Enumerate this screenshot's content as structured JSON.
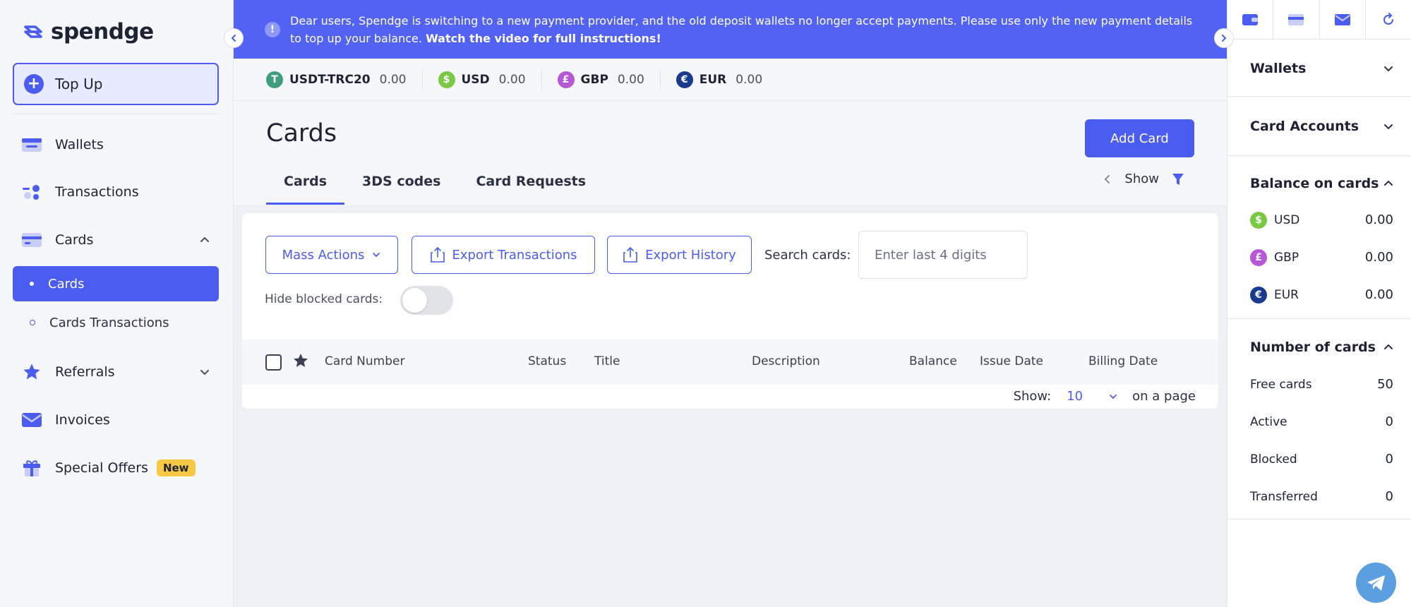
{
  "app": {
    "logo_text": "spendge"
  },
  "sidebar": {
    "topup_label": "Top Up",
    "items": [
      {
        "label": "Wallets"
      },
      {
        "label": "Transactions"
      },
      {
        "label": "Cards"
      },
      {
        "label": "Referrals"
      },
      {
        "label": "Invoices"
      },
      {
        "label": "Special Offers",
        "badge": "New"
      }
    ],
    "cards_sub": [
      {
        "label": "Cards",
        "active": true
      },
      {
        "label": "Cards Transactions",
        "active": false
      }
    ]
  },
  "banner": {
    "text": "Dear users, Spendge is switching to a new payment provider, and the old deposit wallets no longer accept payments. Please use only the new payment details to top up your balance.",
    "link": "Watch the video for full instructions!"
  },
  "balances": [
    {
      "name": "USDT-TRC20",
      "value": "0.00",
      "symbol": "T",
      "color": "#3e9e7c"
    },
    {
      "name": "USD",
      "value": "0.00",
      "symbol": "$",
      "color": "#7ac943"
    },
    {
      "name": "GBP",
      "value": "0.00",
      "symbol": "£",
      "color": "#b557d6"
    },
    {
      "name": "EUR",
      "value": "0.00",
      "symbol": "€",
      "color": "#1a3a8f"
    }
  ],
  "page": {
    "title": "Cards",
    "add_card_label": "Add Card",
    "tabs": [
      {
        "label": "Cards",
        "active": true
      },
      {
        "label": "3DS codes",
        "active": false
      },
      {
        "label": "Card Requests",
        "active": false
      }
    ],
    "show_label": "Show"
  },
  "toolbar": {
    "mass_actions": "Mass Actions",
    "export_transactions": "Export Transactions",
    "export_history": "Export History",
    "search_label": "Search cards:",
    "search_placeholder": "Enter last 4 digits",
    "hide_blocked_label": "Hide blocked cards:",
    "hide_blocked_on": false
  },
  "table": {
    "columns": [
      "Card Number",
      "Status",
      "Title",
      "Description",
      "Balance",
      "Issue Date",
      "Billing Date"
    ]
  },
  "pager": {
    "show_label": "Show:",
    "per_page": "10",
    "suffix": "on a page"
  },
  "right_panel": {
    "wallets_title": "Wallets",
    "card_accounts_title": "Card Accounts",
    "balance_on_cards_title": "Balance on cards",
    "balance_on_cards": [
      {
        "name": "USD",
        "value": "0.00",
        "symbol": "$",
        "color": "#7ac943"
      },
      {
        "name": "GBP",
        "value": "0.00",
        "symbol": "£",
        "color": "#b557d6"
      },
      {
        "name": "EUR",
        "value": "0.00",
        "symbol": "€",
        "color": "#1a3a8f"
      }
    ],
    "number_of_cards_title": "Number of cards",
    "number_of_cards": [
      {
        "name": "Free cards",
        "value": "50"
      },
      {
        "name": "Active",
        "value": "0"
      },
      {
        "name": "Blocked",
        "value": "0"
      },
      {
        "name": "Transferred",
        "value": "0"
      }
    ]
  },
  "colors": {
    "accent": "#4b5cf0",
    "banner": "#5263f4",
    "badge_new": "#f7c843"
  }
}
